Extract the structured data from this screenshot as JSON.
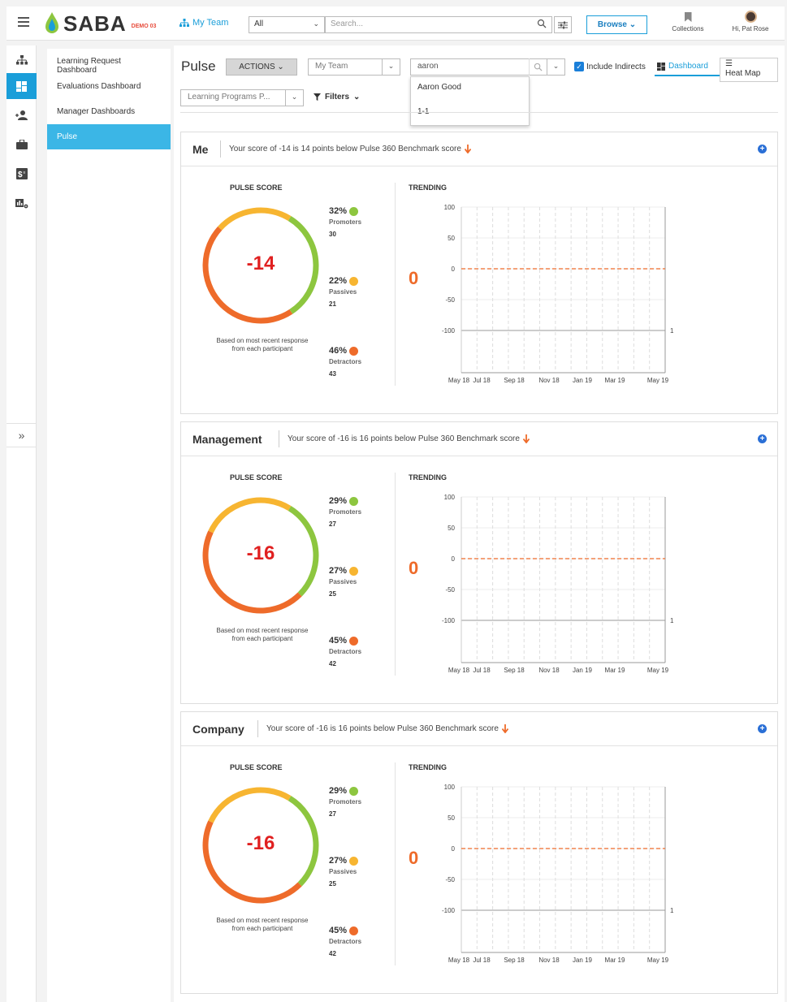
{
  "app": {
    "logo": "SABA",
    "env_badge": "DEMO 03",
    "user_greeting": "Hi, Pat Rose"
  },
  "topbar": {
    "my_team_label": "My Team",
    "scope_value": "All",
    "search_placeholder": "Search...",
    "browse_label": "Browse",
    "collections_label": "Collections"
  },
  "subnav": {
    "items": [
      {
        "label": "Learning Request Dashboard",
        "active": false
      },
      {
        "label": "Evaluations Dashboard",
        "active": false
      },
      {
        "label": "Manager Dashboards",
        "active": false
      },
      {
        "label": "Pulse",
        "active": true
      }
    ]
  },
  "toolbar": {
    "title": "Pulse",
    "actions_label": "ACTIONS",
    "team_select_value": "My Team",
    "person_search_value": "aaron",
    "dropdown_options": [
      "Aaron Good",
      "1-1"
    ],
    "include_indirects_label": "Include Indirects",
    "include_indirects_checked": true,
    "view_dashboard_label": "Dashboard",
    "view_heatmap_label": "Heat Map",
    "program_select_value": "Learning Programs P...",
    "filters_label": "Filters"
  },
  "labels": {
    "pulse_score": "PULSE SCORE",
    "trending": "TRENDING",
    "gauge_note": "Based on most recent response from each participant",
    "promoters": "Promoters",
    "passives": "Passives",
    "detractors": "Detractors"
  },
  "colors": {
    "promoter": "#8dc63f",
    "passive": "#f7b531",
    "detractor": "#ee6b2a",
    "score": "#e02020",
    "accent": "#1a9ed9"
  },
  "cards": [
    {
      "title": "Me",
      "message": "Your score of -14 is 14 points below Pulse 360 Benchmark score",
      "score": "-14",
      "promoters": {
        "pct": "32%",
        "count": "30"
      },
      "passives": {
        "pct": "22%",
        "count": "21"
      },
      "detractors": {
        "pct": "46%",
        "count": "43"
      },
      "trend_value": "0"
    },
    {
      "title": "Management",
      "message": "Your score of -16 is 16 points below Pulse 360 Benchmark score",
      "score": "-16",
      "promoters": {
        "pct": "29%",
        "count": "27"
      },
      "passives": {
        "pct": "27%",
        "count": "25"
      },
      "detractors": {
        "pct": "45%",
        "count": "42"
      },
      "trend_value": "0"
    },
    {
      "title": "Company",
      "message": "Your score of -16 is 16 points below Pulse 360 Benchmark score",
      "score": "-16",
      "promoters": {
        "pct": "29%",
        "count": "27"
      },
      "passives": {
        "pct": "27%",
        "count": "25"
      },
      "detractors": {
        "pct": "45%",
        "count": "42"
      },
      "trend_value": "0"
    }
  ],
  "chart_data": [
    {
      "type": "line",
      "title": "",
      "x_ticks": [
        "May 18",
        "Jul 18",
        "Sep 18",
        "Nov 18",
        "Jan 19",
        "Mar 19",
        "May 19"
      ],
      "y_ticks": [
        100,
        50,
        0,
        -50,
        -100
      ],
      "ylim": [
        -100,
        100
      ],
      "secondary_y_tick": "1",
      "series": [
        {
          "values": [
            0,
            0,
            0,
            0,
            0,
            0,
            0
          ],
          "style": "dashed"
        }
      ],
      "grid": true
    },
    {
      "type": "line",
      "title": "",
      "x_ticks": [
        "May 18",
        "Jul 18",
        "Sep 18",
        "Nov 18",
        "Jan 19",
        "Mar 19",
        "May 19"
      ],
      "y_ticks": [
        100,
        50,
        0,
        -50,
        -100
      ],
      "ylim": [
        -100,
        100
      ],
      "secondary_y_tick": "1",
      "series": [
        {
          "values": [
            0,
            0,
            0,
            0,
            0,
            0,
            0
          ],
          "style": "dashed"
        }
      ],
      "grid": true
    },
    {
      "type": "line",
      "title": "",
      "x_ticks": [
        "May 18",
        "Jul 18",
        "Sep 18",
        "Nov 18",
        "Jan 19",
        "Mar 19",
        "May 19"
      ],
      "y_ticks": [
        100,
        50,
        0,
        -50,
        -100
      ],
      "ylim": [
        -100,
        100
      ],
      "secondary_y_tick": "1",
      "series": [
        {
          "values": [
            0,
            0,
            0,
            0,
            0,
            0,
            0
          ],
          "style": "dashed"
        }
      ],
      "grid": true
    }
  ]
}
